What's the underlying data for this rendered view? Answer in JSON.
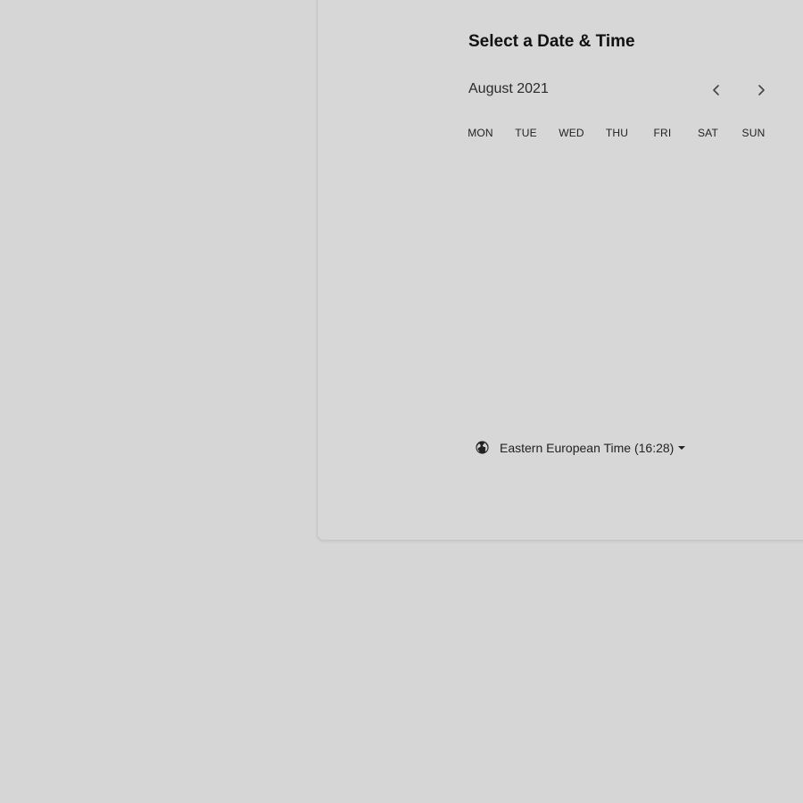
{
  "scheduler": {
    "title": "Select a Date & Time",
    "month": "August 2021",
    "nav": {
      "prev_icon": "chevron-left-icon",
      "next_icon": "chevron-right-icon"
    },
    "weekdays": [
      "MON",
      "TUE",
      "WED",
      "THU",
      "FRI",
      "SAT",
      "SUN"
    ],
    "timezone": {
      "icon": "globe-icon",
      "label": "Eastern European Time (16:28)",
      "dropdown_icon": "caret-down-icon"
    }
  },
  "colors": {
    "background": "#d6d6d6",
    "card": "#d7d7d7",
    "text": "#1a1a1a"
  }
}
